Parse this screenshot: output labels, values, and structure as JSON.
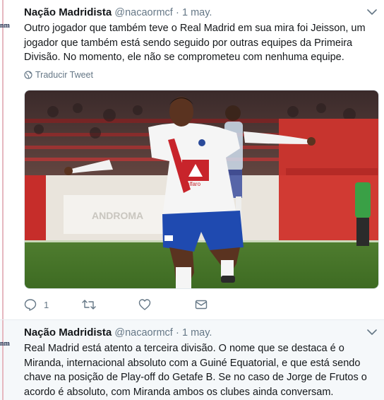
{
  "tweets": [
    {
      "avatar_text": "nm",
      "author_name": "Nação Madridista",
      "handle": "@nacaormcf",
      "separator": "·",
      "date": "1 may.",
      "text": "Outro jogador que também teve o Real Madrid em sua mira foi Jeisson, um jogador que também está sendo seguido por outras equipes da Primeira Divisão. No momento, ele não se comprometeu com nenhuma equipe.",
      "translate_label": "Traducir Tweet",
      "photo": {
        "jersey_text": "alfaro",
        "banner_text": "ANDROMA"
      },
      "actions": {
        "reply_count": "1",
        "retweet_count": "",
        "like_count": ""
      }
    },
    {
      "avatar_text": "nm",
      "author_name": "Nação Madridista",
      "handle": "@nacaormcf",
      "separator": "·",
      "date": "1 may.",
      "text": "Real Madrid está atento a terceira divisão. O nome que se destaca é o Miranda, internacional absoluto com a Guiné Equatorial, e que está sendo chave na posição de Play-off do Getafe B. Se no caso de Jorge de Frutos o acordo é absoluto, com Miranda ambos os clubes ainda conversam."
    }
  ],
  "icons": {
    "caret": "chevron-down-icon",
    "globe": "globe-icon",
    "reply": "reply-icon",
    "retweet": "retweet-icon",
    "like": "heart-icon",
    "dm": "envelope-icon"
  },
  "colors": {
    "name": "#14171a",
    "muted": "#657786",
    "thread_line": "#e6b8c0",
    "selected_bg": "#f5f8fa"
  }
}
